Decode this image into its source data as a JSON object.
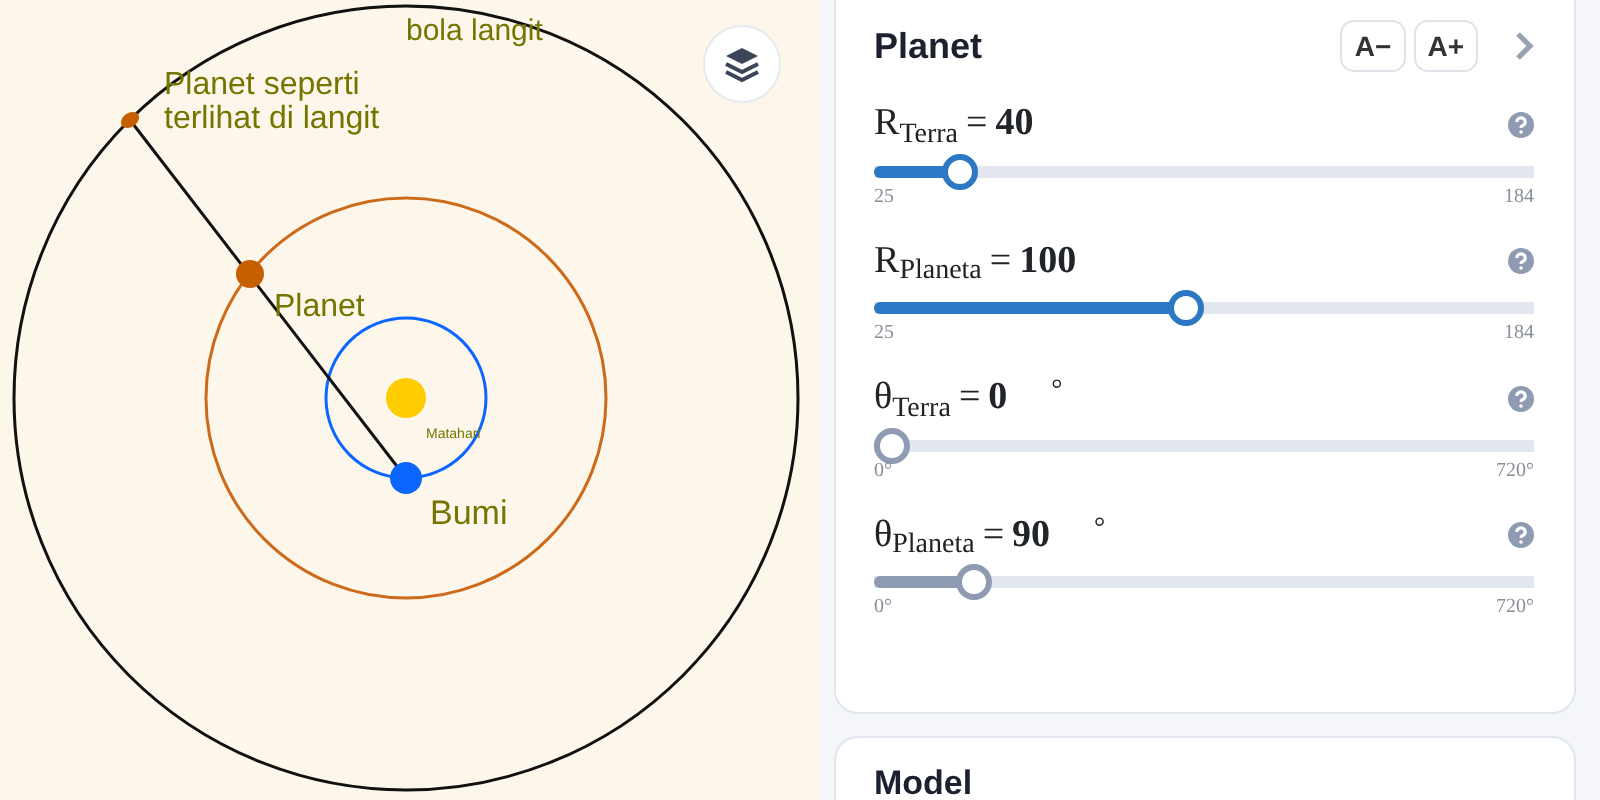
{
  "diagram": {
    "labels": {
      "celestial_sphere": "bola langit",
      "apparent_planet": [
        "Planet seperti",
        "terlihat di langit"
      ],
      "planet": "Planet",
      "sun": "Matahari",
      "earth": "Bumi"
    }
  },
  "panel": {
    "title": "Planet",
    "font_buttons": [
      "A−",
      "A+"
    ],
    "sliders": [
      {
        "label": "R$_{Terra}$",
        "equals": "=",
        "value": "40",
        "level": 0.11,
        "min": "25",
        "max": "184",
        "color": "#2c78c4"
      },
      {
        "label": "R$_{Planeta}$",
        "equals": "=",
        "value": "100",
        "level": 0.47,
        "min": "25",
        "max": "184",
        "color": "#2c78c4"
      },
      {
        "label": "θ$_{Terra}$",
        "equals": "=",
        "value": "0",
        "unit": "°",
        "level": 0,
        "min": "0°",
        "max": "720°",
        "color": "#8f9bb3"
      },
      {
        "label": "θ$_{Planeta}$",
        "equals": "=",
        "value": "90",
        "unit": "°",
        "level": 0.13,
        "min": "0°",
        "max": "720°",
        "color": "#8f9bb3"
      }
    ]
  },
  "next_card": {
    "title": "Model"
  }
}
